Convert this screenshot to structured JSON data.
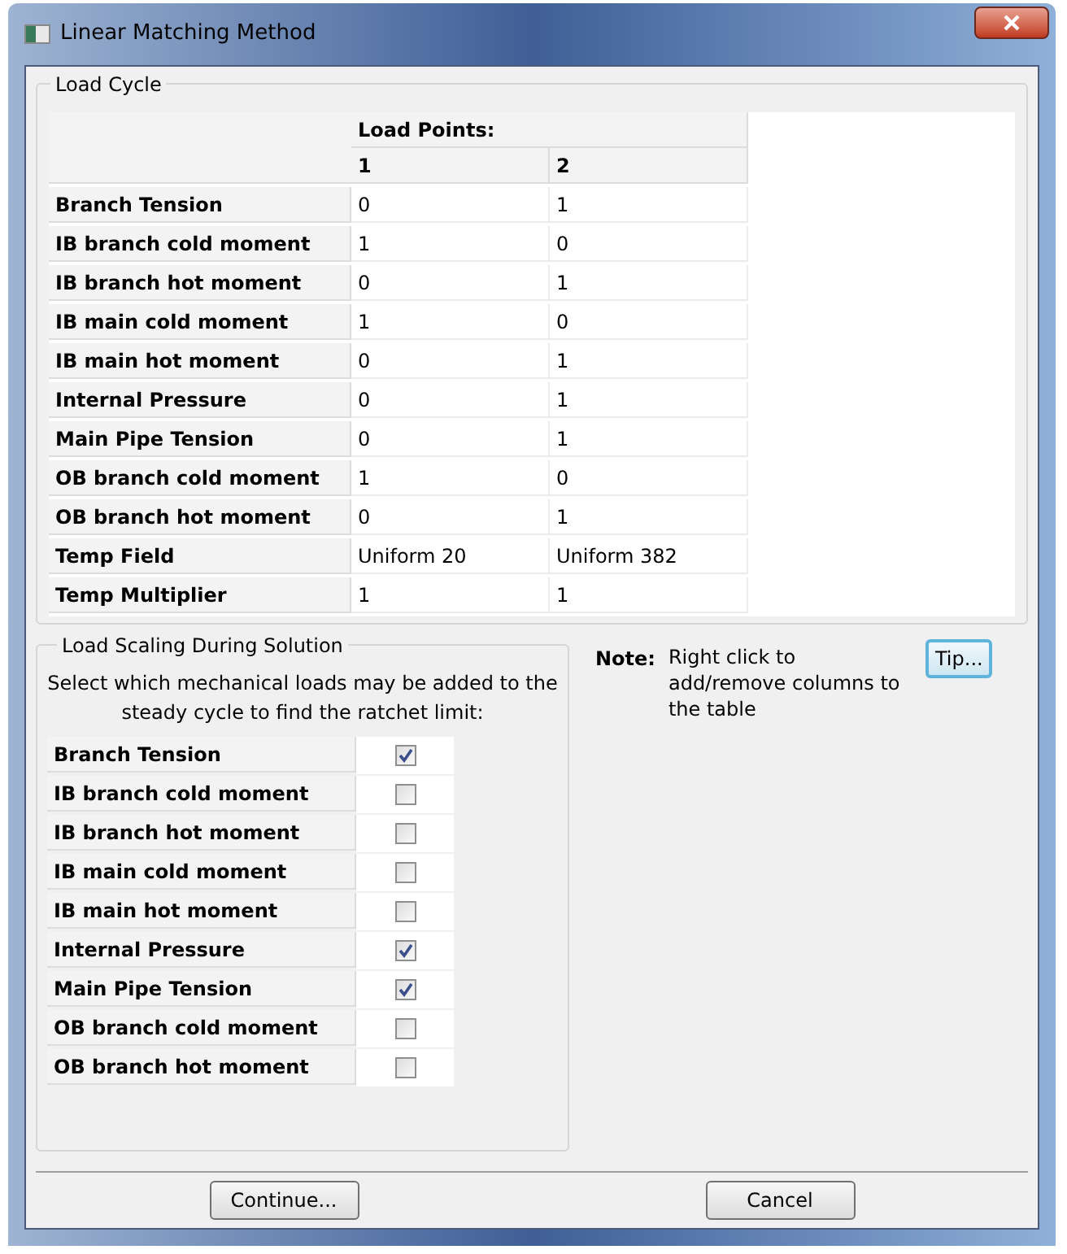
{
  "window": {
    "title": "Linear Matching Method"
  },
  "load_cycle": {
    "title": "Load Cycle",
    "header": "Load Points:",
    "columns": [
      "1",
      "2"
    ],
    "rows": [
      {
        "label": "Branch Tension",
        "values": [
          "0",
          "1"
        ]
      },
      {
        "label": "IB branch cold moment",
        "values": [
          "1",
          "0"
        ]
      },
      {
        "label": "IB branch hot moment",
        "values": [
          "0",
          "1"
        ]
      },
      {
        "label": "IB main cold moment",
        "values": [
          "1",
          "0"
        ]
      },
      {
        "label": "IB main hot moment",
        "values": [
          "0",
          "1"
        ]
      },
      {
        "label": "Internal Pressure",
        "values": [
          "0",
          "1"
        ]
      },
      {
        "label": "Main Pipe Tension",
        "values": [
          "0",
          "1"
        ]
      },
      {
        "label": "OB branch cold moment",
        "values": [
          "1",
          "0"
        ]
      },
      {
        "label": "OB branch hot moment",
        "values": [
          "0",
          "1"
        ]
      },
      {
        "label": "Temp Field",
        "values": [
          "Uniform 20",
          "Uniform 382"
        ]
      },
      {
        "label": "Temp Multiplier",
        "values": [
          "1",
          "1"
        ]
      }
    ]
  },
  "load_scaling": {
    "title": "Load Scaling During Solution",
    "instructions": "Select which mechanical loads may be added to the steady cycle to find the ratchet limit:",
    "items": [
      {
        "label": "Branch Tension",
        "checked": true
      },
      {
        "label": "IB branch cold moment",
        "checked": false
      },
      {
        "label": "IB branch hot moment",
        "checked": false
      },
      {
        "label": "IB main cold moment",
        "checked": false
      },
      {
        "label": "IB main hot moment",
        "checked": false
      },
      {
        "label": "Internal Pressure",
        "checked": true
      },
      {
        "label": "Main Pipe Tension",
        "checked": true
      },
      {
        "label": "OB branch cold moment",
        "checked": false
      },
      {
        "label": "OB branch hot moment",
        "checked": false
      }
    ]
  },
  "note": {
    "label": "Note:",
    "text": "Right click to add/remove columns to the table",
    "button": "Tip..."
  },
  "buttons": [
    "Continue...",
    "Cancel"
  ]
}
